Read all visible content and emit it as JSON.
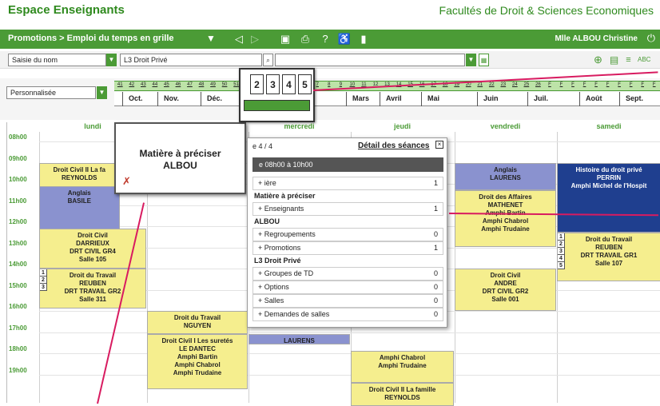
{
  "header": {
    "left_title": "Espace Enseignants",
    "right_title": "Facultés de Droit & Sciences Economiques"
  },
  "navbar": {
    "breadcrumb": "Promotions > Emploi du temps en grille",
    "user": "Mlle ALBOU Christine"
  },
  "selection": {
    "mode": "Saisie du nom",
    "promotion": "L3 Droit Privé",
    "period": "Personnalisée"
  },
  "weeks": [
    "41",
    "42",
    "43",
    "44",
    "45",
    "46",
    "47",
    "48",
    "49",
    "50",
    "51",
    "F",
    "2",
    "3",
    "4",
    "5",
    "F",
    "7",
    "8",
    "9",
    "10",
    "11",
    "12",
    "13",
    "14",
    "15",
    "16",
    "17",
    "18",
    "19",
    "20",
    "21",
    "22",
    "23",
    "24",
    "25",
    "26",
    "F",
    "F",
    "F",
    "F",
    "F",
    "F",
    "F",
    "F",
    "F",
    "F"
  ],
  "months": [
    "Oct.",
    "Nov.",
    "Déc.",
    "Mars",
    "Avril",
    "Mai",
    "Juin",
    "Juil.",
    "Août",
    "Sept."
  ],
  "zoom_weeks": [
    "2",
    "3",
    "4",
    "5"
  ],
  "days": [
    "lundi",
    "mardi",
    "mercredi",
    "jeudi",
    "vendredi",
    "samedi"
  ],
  "hours": [
    "08h00",
    "09h00",
    "10h00",
    "11h00",
    "12h00",
    "13h00",
    "14h00",
    "15h00",
    "16h00",
    "17h00",
    "18h00",
    "19h00"
  ],
  "courses": [
    {
      "lines": [
        "Droit Civil II La fa",
        "REYNOLDS"
      ]
    },
    {
      "lines": [
        "Anglais",
        "BASILE"
      ]
    },
    {
      "lines": [
        "Droit Civil",
        "DARRIEUX",
        "DRT CIVIL GR4",
        "Salle 105"
      ]
    },
    {
      "lines": [
        "Droit du Travail",
        "REUBEN",
        "DRT TRAVAIL GR2",
        "Salle 311"
      ]
    },
    {
      "lines": [
        "Droit du Travail",
        "NGUYEN"
      ]
    },
    {
      "lines": [
        "Droit Civil I Les suretés",
        "LE DANTEC",
        "Amphi Bartin",
        "Amphi Chabrol",
        "Amphi Trudaine"
      ]
    },
    {
      "lines": [
        "LAURENS"
      ]
    },
    {
      "lines": [
        "Amphi Chabrol",
        "Amphi Trudaine"
      ]
    },
    {
      "lines": [
        "Droit Civil II La famille",
        "REYNOLDS"
      ]
    },
    {
      "lines": [
        "Anglais",
        "LAURENS"
      ]
    },
    {
      "lines": [
        "Droit des Affaires",
        "MATHENET",
        "Amphi Bartin",
        "Amphi Chabrol",
        "Amphi Trudaine"
      ]
    },
    {
      "lines": [
        "Droit Civil",
        "ANDRE",
        "DRT CIVIL GR2",
        "Salle 001"
      ]
    },
    {
      "lines": [
        "Histoire du droit privé",
        "PERRIN",
        "Amphi Michel de l'Hospit"
      ]
    },
    {
      "lines": [
        "Droit du Travail",
        "REUBEN",
        "DRT TRAVAIL GR1",
        "Salle 107"
      ]
    }
  ],
  "markers_a": [
    "1",
    "2",
    "3"
  ],
  "markers_b": [
    "1",
    "2",
    "3",
    "4",
    "5"
  ],
  "popup": {
    "title": "Matière à préciser",
    "teacher": "ALBOU"
  },
  "detail": {
    "counter": "e 4 / 4",
    "link": "Détail des séances",
    "time": "e 08h00 à 10h00",
    "rows": [
      {
        "label": "ière",
        "count": "1",
        "value": "Matière à préciser"
      },
      {
        "label": "Enseignants",
        "count": "1",
        "value": "ALBOU"
      },
      {
        "label": "Regroupements",
        "count": "0",
        "value": ""
      },
      {
        "label": "Promotions",
        "count": "1",
        "value": "L3 Droit Privé"
      },
      {
        "label": "Groupes de TD",
        "count": "0",
        "value": ""
      },
      {
        "label": "Options",
        "count": "0",
        "value": ""
      },
      {
        "label": "Salles",
        "count": "0",
        "value": ""
      },
      {
        "label": "Demandes de salles",
        "count": "0",
        "value": ""
      }
    ]
  },
  "colors": {
    "brand_green": "#4b9b36",
    "course_yellow": "#f5ee8e",
    "course_purple": "#8a92cf",
    "course_blue": "#1f3f8f",
    "arrow": "#d81b60"
  }
}
